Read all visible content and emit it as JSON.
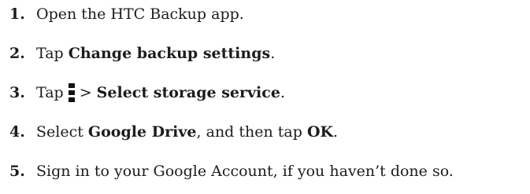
{
  "steps": [
    {
      "number": "1.",
      "parts": [
        {
          "text": "Open the HTC Backup app.",
          "bold": false
        }
      ]
    },
    {
      "number": "2.",
      "parts": [
        {
          "text": "Tap ",
          "bold": false
        },
        {
          "text": "Change backup settings",
          "bold": true
        },
        {
          "text": ".",
          "bold": false
        }
      ]
    },
    {
      "number": "3.",
      "parts": [
        {
          "text": "Tap",
          "bold": false
        },
        {
          "icon": "menu-more-icon"
        },
        {
          "text": "> ",
          "bold": false
        },
        {
          "text": "Select storage service",
          "bold": true
        },
        {
          "text": ".",
          "bold": false
        }
      ]
    },
    {
      "number": "4.",
      "parts": [
        {
          "text": "Select ",
          "bold": false
        },
        {
          "text": "Google Drive",
          "bold": true
        },
        {
          "text": ", and then tap ",
          "bold": false
        },
        {
          "text": "OK",
          "bold": true
        },
        {
          "text": ".",
          "bold": false
        }
      ]
    },
    {
      "number": "5.",
      "parts": [
        {
          "text": "Sign in to your Google Account, if you haven’t done so.",
          "bold": false
        }
      ]
    }
  ]
}
